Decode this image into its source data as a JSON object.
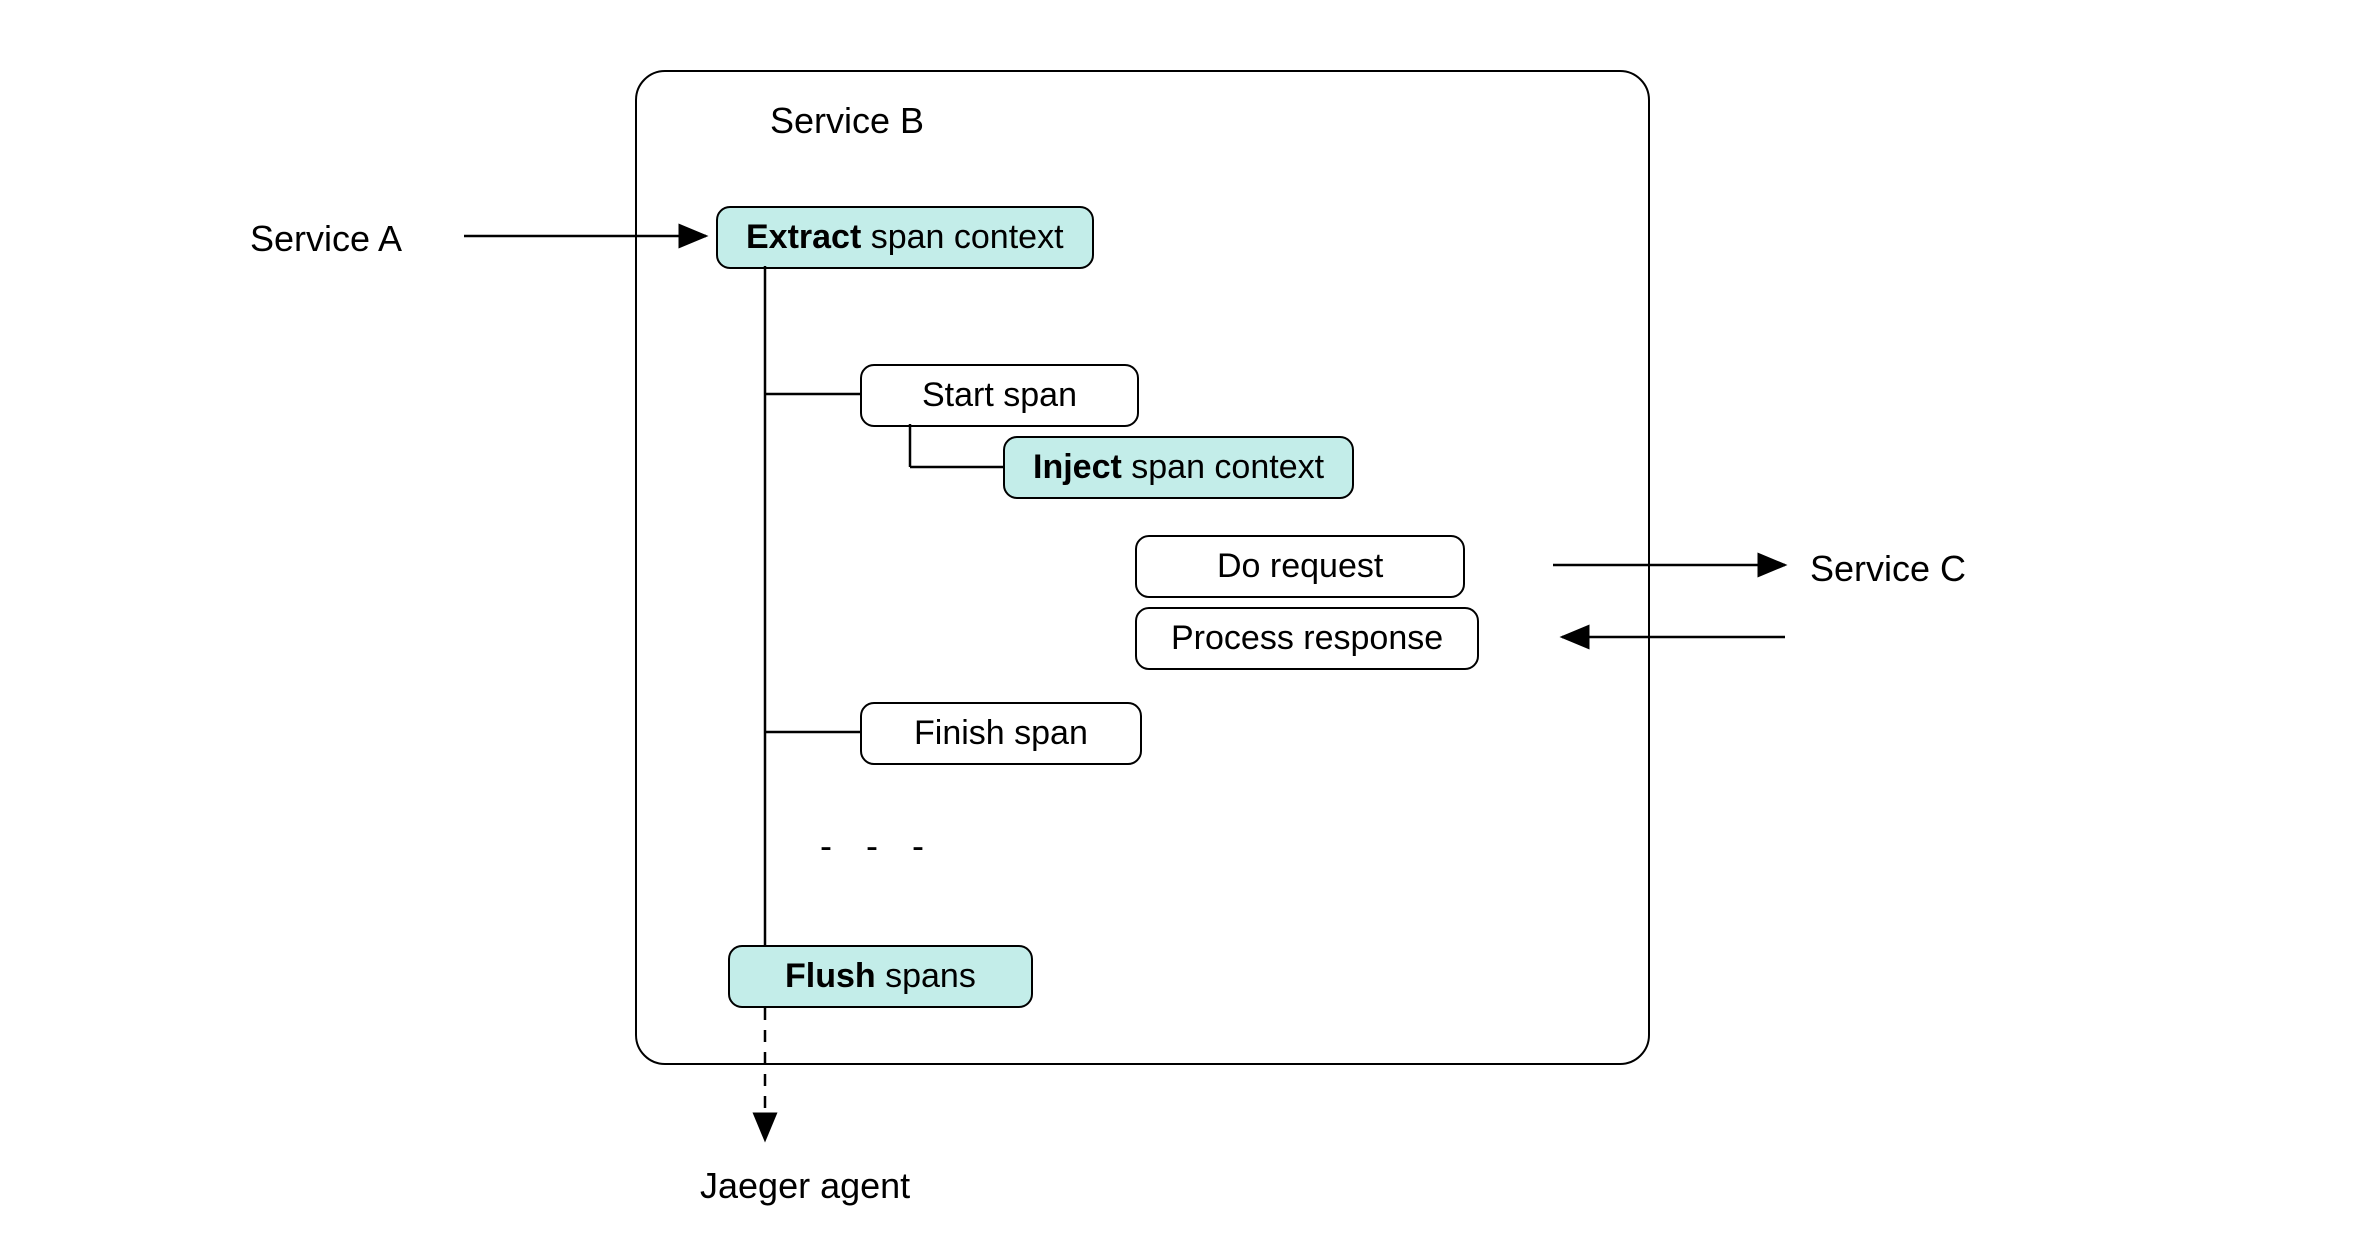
{
  "labels": {
    "service_a": "Service A",
    "service_b": "Service B",
    "service_c": "Service C",
    "jaeger_agent": "Jaeger agent",
    "ellipsis": "- - -"
  },
  "nodes": {
    "extract": {
      "bold": "Extract",
      "rest": " span context"
    },
    "start_span": {
      "text": "Start span"
    },
    "inject": {
      "bold": "Inject",
      "rest": " span context"
    },
    "do_request": {
      "text": "Do request"
    },
    "process_response": {
      "text": "Process response"
    },
    "finish_span": {
      "text": "Finish span"
    },
    "flush": {
      "bold": "Flush",
      "rest": " spans"
    }
  }
}
